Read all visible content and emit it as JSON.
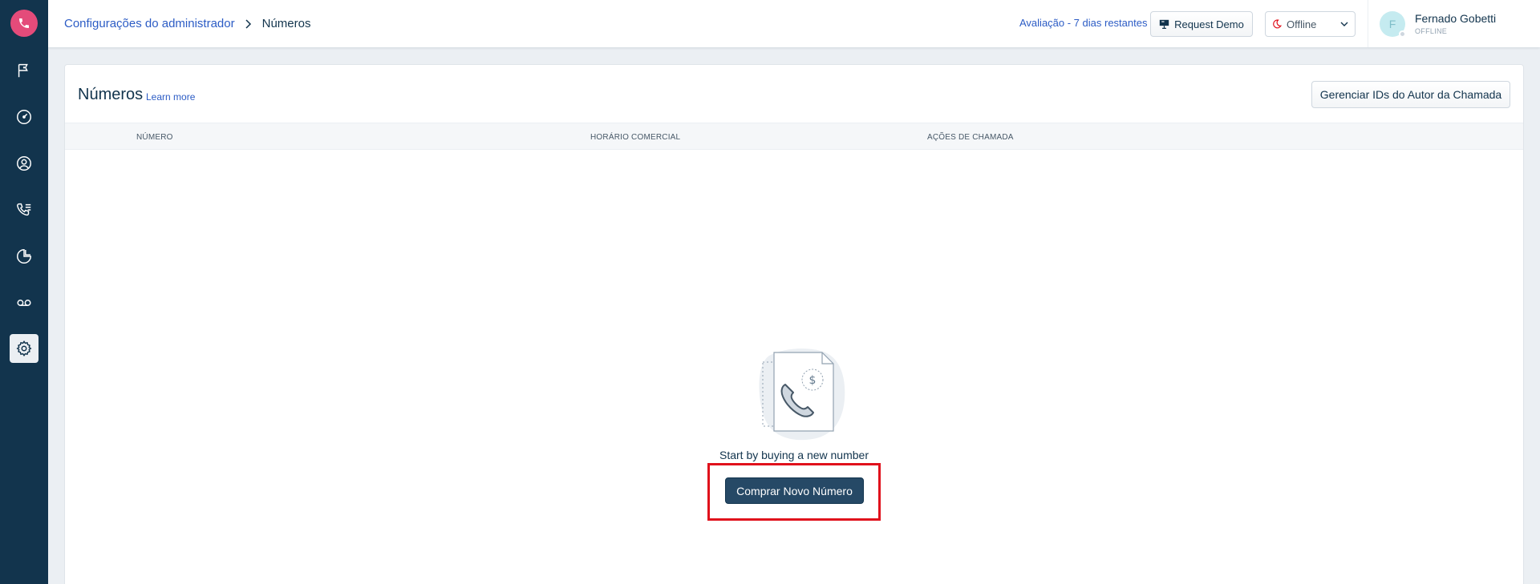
{
  "breadcrumb": {
    "parent": "Configurações do administrador",
    "current": "Números"
  },
  "topbar": {
    "trial_text": "Avaliação - 7 dias restantes",
    "demo_label": "Request Demo",
    "status_value": "Offline"
  },
  "user": {
    "initial": "F",
    "name": "Fernado Gobetti",
    "status": "OFFLINE"
  },
  "sidebar": {
    "items": [
      "phone-icon",
      "flag-icon",
      "dashboard-icon",
      "contacts-icon",
      "call-log-icon",
      "reports-icon",
      "voicemail-icon",
      "settings-icon"
    ]
  },
  "page": {
    "title": "Números",
    "learn_more": "Learn more",
    "caller_ids_button": "Gerenciar IDs do Autor da Chamada"
  },
  "table": {
    "columns": [
      "NÚMERO",
      "HORÁRIO COMERCIAL",
      "AÇÕES DE CHAMADA"
    ]
  },
  "empty_state": {
    "message": "Start by buying a new number",
    "button_label": "Comprar Novo Número"
  },
  "colors": {
    "sidebar": "#12344d",
    "brand_logo": "#e44b7a",
    "link": "#2c5cc5",
    "primary_button": "#264966",
    "highlight": "#e0111c"
  }
}
